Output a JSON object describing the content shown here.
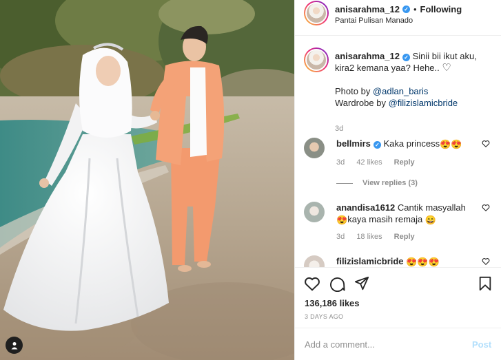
{
  "post": {
    "username": "anisarahma_12",
    "verified": true,
    "follow_status": "Following",
    "location": "Pantai Pulisan Manado",
    "user_tag_icon": "person-icon"
  },
  "caption": {
    "username": "anisarahma_12",
    "text_line1": "Sinii bii ikut aku,",
    "text_line2": "kira2 kemana yaa? Hehe..",
    "emoji": "♡",
    "photo_label": "Photo by",
    "photo_mention": "@adlan_baris",
    "wardrobe_label": "Wardrobe by",
    "wardrobe_mention": "@filizislamicbride",
    "time": "3d"
  },
  "comments": [
    {
      "username": "bellmirs",
      "verified": true,
      "text": "Kaka princess",
      "emojis": "😍😍",
      "time": "3d",
      "likes": "42 likes",
      "reply": "Reply",
      "view_replies": "View replies (3)"
    },
    {
      "username": "anandisa1612",
      "verified": false,
      "text_part1": "Cantik masyallah",
      "emoji_mid": "😍",
      "text_part2": "kaya masih remaja",
      "emoji_end": "😄",
      "time": "3d",
      "likes": "18 likes",
      "reply": "Reply"
    },
    {
      "username": "filizislamicbride",
      "verified": false,
      "emojis": "😍😍😍"
    }
  ],
  "actions": {
    "like_icon": "heart-icon",
    "comment_icon": "comment-icon",
    "share_icon": "paper-plane-icon",
    "save_icon": "bookmark-icon",
    "likes": "136,186 likes",
    "posted": "3 DAYS AGO"
  },
  "add_comment": {
    "placeholder": "Add a comment...",
    "post_label": "Post"
  },
  "colors": {
    "link": "#00376b",
    "verified": "#3897f0",
    "post_disabled": "#b2dffc",
    "muted": "#8e8e8e"
  }
}
